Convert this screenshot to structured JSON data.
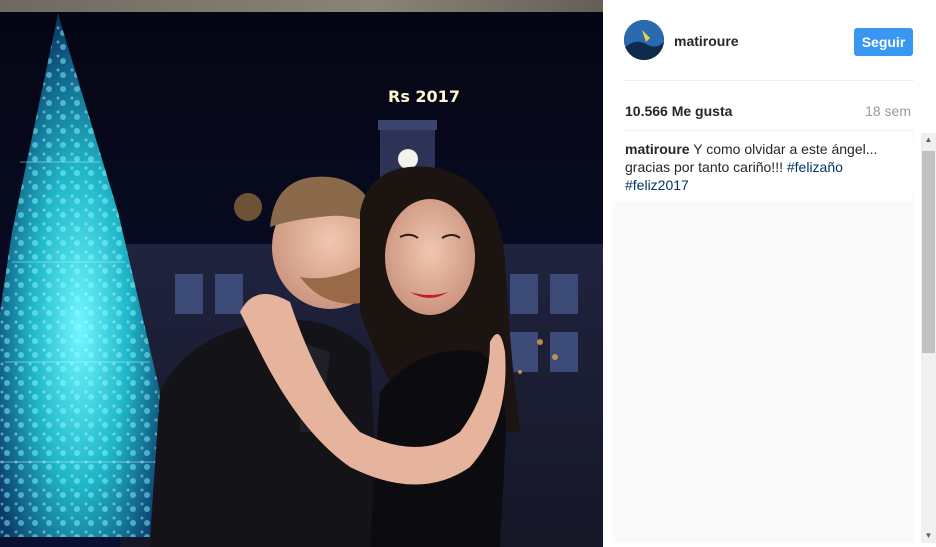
{
  "post": {
    "username": "matiroure",
    "follow_label": "Seguir",
    "likes": "10.566 Me gusta",
    "time_ago": "18 sem",
    "caption_user": "matiroure",
    "caption_text": " Y como olvidar a este ángel... gracias por tanto cariño!!! ",
    "hashtags": [
      "#felizaño",
      "#feliz2017"
    ]
  },
  "photo": {
    "clock_sign": "Rs 2017",
    "description_icon": "photo-image"
  },
  "colors": {
    "accent": "#3897f0",
    "hashtag": "#003569",
    "muted": "#999999",
    "text": "#262626"
  }
}
